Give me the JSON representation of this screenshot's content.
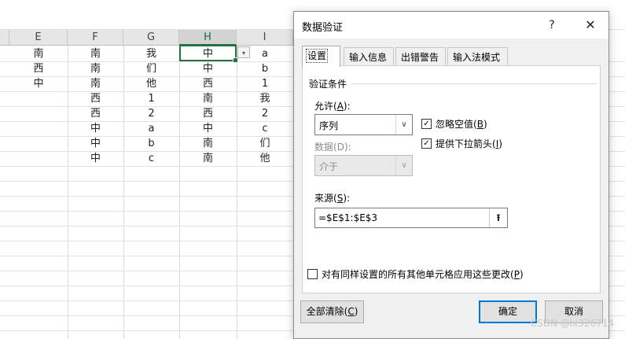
{
  "sheet": {
    "columns": [
      "E",
      "F",
      "G",
      "H",
      "I"
    ],
    "selected_column": "H",
    "rows": [
      [
        "南",
        "南",
        "我",
        "中",
        "a"
      ],
      [
        "西",
        "南",
        "们",
        "中",
        "b"
      ],
      [
        "中",
        "南",
        "他",
        "西",
        "1"
      ],
      [
        "",
        "西",
        "1",
        "南",
        "我"
      ],
      [
        "",
        "西",
        "2",
        "西",
        "2"
      ],
      [
        "",
        "中",
        "a",
        "中",
        "c"
      ],
      [
        "",
        "中",
        "b",
        "南",
        "们"
      ],
      [
        "",
        "中",
        "c",
        "南",
        "他"
      ]
    ],
    "active_cell": "H1",
    "dropdown_icon": "▾"
  },
  "dialog": {
    "title": "数据验证",
    "help_label": "?",
    "close_label": "✕",
    "tabs": [
      {
        "label": "设置",
        "active": true
      },
      {
        "label": "输入信息",
        "active": false
      },
      {
        "label": "出错警告",
        "active": false
      },
      {
        "label": "输入法模式",
        "active": false
      }
    ],
    "settings": {
      "group_title": "验证条件",
      "allow_label": "允许",
      "allow_key": "A",
      "allow_value": "序列",
      "data_label": "数据",
      "data_key": "D",
      "data_value": "介于",
      "ignore_blank_label": "忽略空值",
      "ignore_blank_key": "B",
      "ignore_blank_checked": true,
      "dropdown_label": "提供下拉箭头",
      "dropdown_key": "I",
      "dropdown_checked": true,
      "source_label": "来源",
      "source_key": "S",
      "source_value": "=$E$1:$E$3",
      "apply_all_label": "对有同样设置的所有其他单元格应用这些更改",
      "apply_all_key": "P",
      "apply_all_checked": false
    },
    "buttons": {
      "clear_all": "全部清除",
      "clear_all_key": "C",
      "ok": "确定",
      "cancel": "取消"
    }
  },
  "watermark": "CSDN @lx326714",
  "colors": {
    "excel_green": "#217346",
    "default_button_border": "#0078d7"
  }
}
